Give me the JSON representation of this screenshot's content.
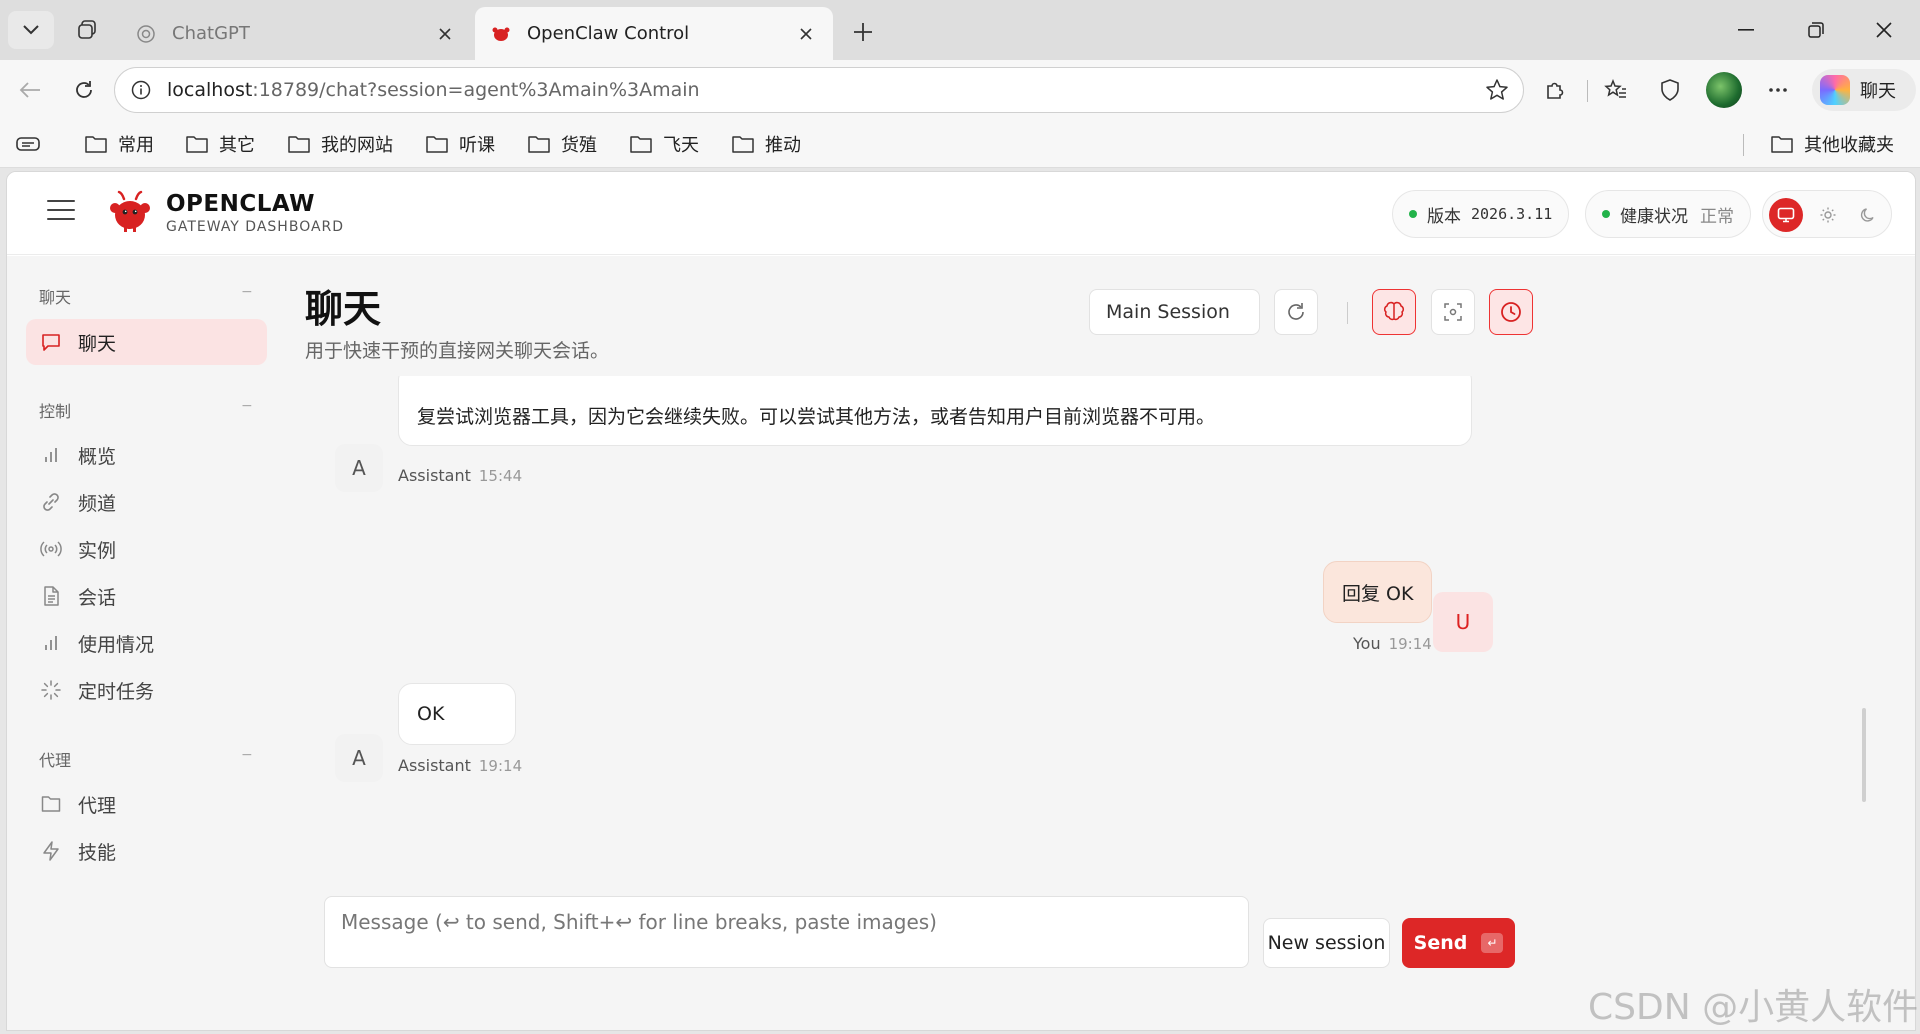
{
  "browser": {
    "tabs": [
      {
        "title": "ChatGPT",
        "active": false
      },
      {
        "title": "OpenClaw Control",
        "active": true
      }
    ],
    "url_host": "localhost",
    "url_path": ":18789/chat?session=agent%3Amain%3Amain",
    "copilot_label": "聊天",
    "bookmarks": [
      "常用",
      "其它",
      "我的网站",
      "听课",
      "货殖",
      "飞天",
      "推动"
    ],
    "other_bookmarks": "其他收藏夹"
  },
  "app": {
    "brand_name": "OPENCLAW",
    "brand_sub": "GATEWAY DASHBOARD",
    "version_label": "版本",
    "version_value": "2026.3.11",
    "health_label": "健康状况",
    "health_value": "正常"
  },
  "sidebar": {
    "groups": [
      {
        "title": "聊天",
        "collapse": "−",
        "items": [
          {
            "label": "聊天",
            "icon": "message-square-icon",
            "active": true
          }
        ]
      },
      {
        "title": "控制",
        "collapse": "−",
        "items": [
          {
            "label": "概览",
            "icon": "bar-chart-icon"
          },
          {
            "label": "频道",
            "icon": "link-icon"
          },
          {
            "label": "实例",
            "icon": "radio-icon"
          },
          {
            "label": "会话",
            "icon": "file-text-icon"
          },
          {
            "label": "使用情况",
            "icon": "bar-chart-icon"
          },
          {
            "label": "定时任务",
            "icon": "loader-icon"
          }
        ]
      },
      {
        "title": "代理",
        "collapse": "−",
        "items": [
          {
            "label": "代理",
            "icon": "folder-icon"
          },
          {
            "label": "技能",
            "icon": "zap-icon"
          }
        ]
      }
    ]
  },
  "main": {
    "title": "聊天",
    "subtitle": "用于快速干预的直接网关聊天会话。",
    "session_select": "Main Session",
    "messages": [
      {
        "role": "assistant",
        "avatar": "A",
        "text": "复尝试浏览器工具，因为它会继续失败。可以尝试其他方法，或者告知用户目前浏览器不可用。",
        "sender": "Assistant",
        "time": "15:44"
      },
      {
        "role": "user",
        "avatar": "U",
        "text": "回复 OK",
        "sender": "You",
        "time": "19:14"
      },
      {
        "role": "assistant",
        "avatar": "A",
        "text": "OK",
        "sender": "Assistant",
        "time": "19:14"
      }
    ],
    "composer_placeholder": "Message (↩ to send, Shift+↩ for line breaks, paste images)",
    "new_session_label": "New session",
    "send_label": "Send",
    "send_kbd": "↵"
  },
  "watermark": "CSDN @小黄人软件",
  "colors": {
    "accent": "#dd2727",
    "active_nav_bg": "#fbe3e3",
    "health_dot": "#22b34a"
  }
}
